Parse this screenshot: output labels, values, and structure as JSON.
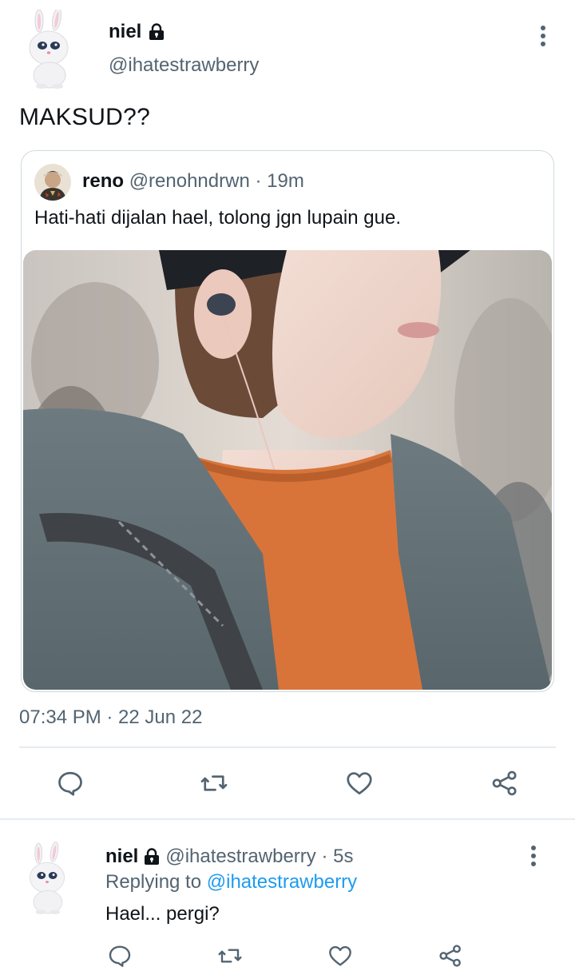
{
  "main_tweet": {
    "author_name": "niel",
    "author_handle": "@ihatestrawberry",
    "text": "MAKSUD??",
    "timestamp": "07:34 PM · 22 Jun 22",
    "avatar_icon": "bunny-avatar-icon",
    "lock_icon": "lock-icon",
    "quoted": {
      "author_name": "reno",
      "author_meta": "@renohndrwn · 19m",
      "text": "Hati-hati dijalan hael, tolong jgn lupain gue.",
      "image": "person-photo"
    },
    "actions": [
      "reply-icon",
      "retweet-icon",
      "like-icon",
      "share-icon"
    ]
  },
  "reply_tweet": {
    "author_name": "niel",
    "author_meta": "@ihatestrawberry · 5s",
    "replying_to_label": "Replying to",
    "replying_to_mention": "@ihatestrawberry",
    "text": "Hael... pergi?"
  },
  "colors": {
    "text": "#0f1419",
    "muted": "#536471",
    "accent": "#1d9bf0",
    "border": "#cfd9de",
    "icon": "#536471"
  }
}
